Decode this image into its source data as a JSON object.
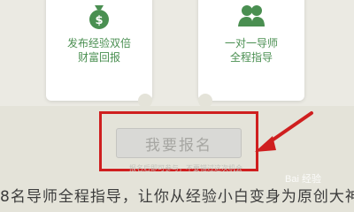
{
  "cards": [
    {
      "line1": "发布经验双倍",
      "line2": "财富回报",
      "icon": "money-bag-icon"
    },
    {
      "line1": "一对一导师",
      "line2": "全程指导",
      "icon": "mentor-people-icon"
    }
  ],
  "cta": {
    "label": "我要报名"
  },
  "note": {
    "text": "报名后即可参与，不要错过这次机会"
  },
  "footer": {
    "text": "8名导师全程指导，让你从经验小白变身为原创大神"
  },
  "watermark": {
    "text": "Bai 经验"
  },
  "colors": {
    "accent_green": "#4a8f51",
    "highlight_red": "#cf1f1f"
  }
}
